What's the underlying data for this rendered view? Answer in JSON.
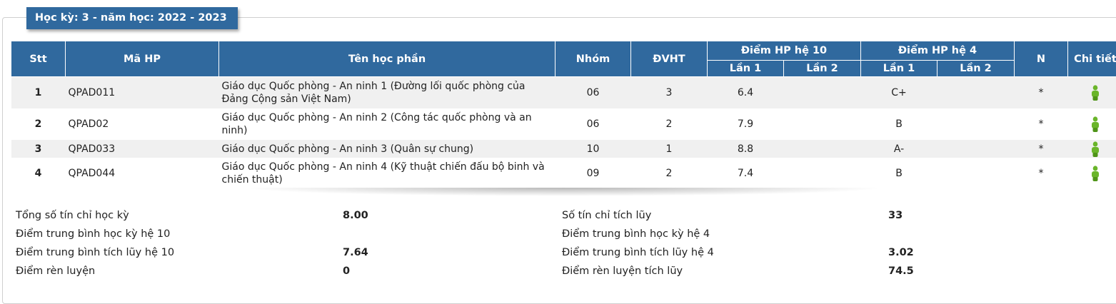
{
  "semester_title": "Học kỳ: 3 - năm học: 2022 - 2023",
  "headers": {
    "stt": "Stt",
    "ma_hp": "Mã HP",
    "ten_hp": "Tên học phần",
    "nhom": "Nhóm",
    "dvht": "ĐVHT",
    "diem10": "Điểm HP hệ 10",
    "diem4": "Điểm HP hệ 4",
    "lan1": "Lần 1",
    "lan2": "Lần 2",
    "n": "N",
    "chi_tiet": "Chi tiết"
  },
  "rows": [
    {
      "stt": "1",
      "ma": "QPAD011",
      "ten": "Giáo dục Quốc phòng - An ninh 1 (Đường lối quốc phòng của Đảng Cộng sản Việt Nam)",
      "nhom": "06",
      "dvht": "3",
      "d10_1": "6.4",
      "d10_2": "",
      "d4_1": "C+",
      "d4_2": "",
      "n": "*"
    },
    {
      "stt": "2",
      "ma": "QPAD02",
      "ten": "Giáo dục Quốc phòng - An ninh 2 (Công tác quốc phòng và an ninh)",
      "nhom": "06",
      "dvht": "2",
      "d10_1": "7.9",
      "d10_2": "",
      "d4_1": "B",
      "d4_2": "",
      "n": "*"
    },
    {
      "stt": "3",
      "ma": "QPAD033",
      "ten": "Giáo dục Quốc phòng - An ninh 3 (Quân sự chung)",
      "nhom": "10",
      "dvht": "1",
      "d10_1": "8.8",
      "d10_2": "",
      "d4_1": "A-",
      "d4_2": "",
      "n": "*"
    },
    {
      "stt": "4",
      "ma": "QPAD044",
      "ten": "Giáo dục Quốc phòng - An ninh 4 (Kỹ thuật chiến đấu bộ binh và chiến thuật)",
      "nhom": "09",
      "dvht": "2",
      "d10_1": "7.4",
      "d10_2": "",
      "d4_1": "B",
      "d4_2": "",
      "n": "*"
    }
  ],
  "summary_left": [
    {
      "label": "Tổng số tín chỉ học kỳ",
      "value": "8.00"
    },
    {
      "label": "Điểm trung bình học kỳ hệ 10",
      "value": ""
    },
    {
      "label": "Điểm trung bình tích lũy hệ 10",
      "value": "7.64"
    },
    {
      "label": "Điểm rèn luyện",
      "value": "0"
    }
  ],
  "summary_right": [
    {
      "label": "Số tín chỉ tích lũy",
      "value": "33"
    },
    {
      "label": "Điểm trung bình học kỳ hệ 4",
      "value": ""
    },
    {
      "label": "Điểm trung bình tích lũy hệ 4",
      "value": "3.02"
    },
    {
      "label": "Điểm rèn luyện tích lũy",
      "value": "74.5"
    }
  ],
  "colors": {
    "header_bg": "#30699e",
    "icon_green": "#6ab52a"
  },
  "icons": {
    "detail": "green-figure-icon"
  }
}
